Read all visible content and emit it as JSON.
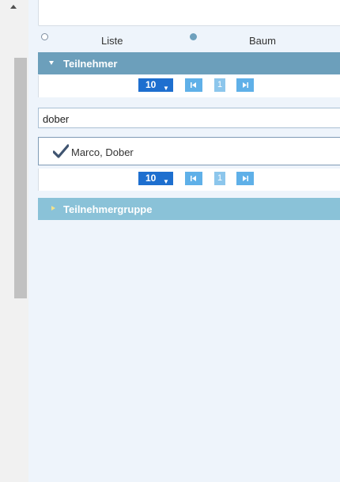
{
  "view_options": {
    "liste_label": "Liste",
    "baum_label": "Baum",
    "selected": "Baum"
  },
  "teilnehmer": {
    "header_label": "Teilnehmer",
    "page_size": "10",
    "current_page": "1",
    "search_value": "dober",
    "results": [
      {
        "label": "Marco, Dober",
        "checked": true
      }
    ]
  },
  "teilnehmergruppe": {
    "header_label": "Teilnehmergruppe"
  },
  "colors": {
    "header_expanded": "#6c9fbb",
    "header_collapsed": "#8ac2d8",
    "page_size_bg": "#1e6fcf",
    "pager_button": "#5fb0e8"
  }
}
